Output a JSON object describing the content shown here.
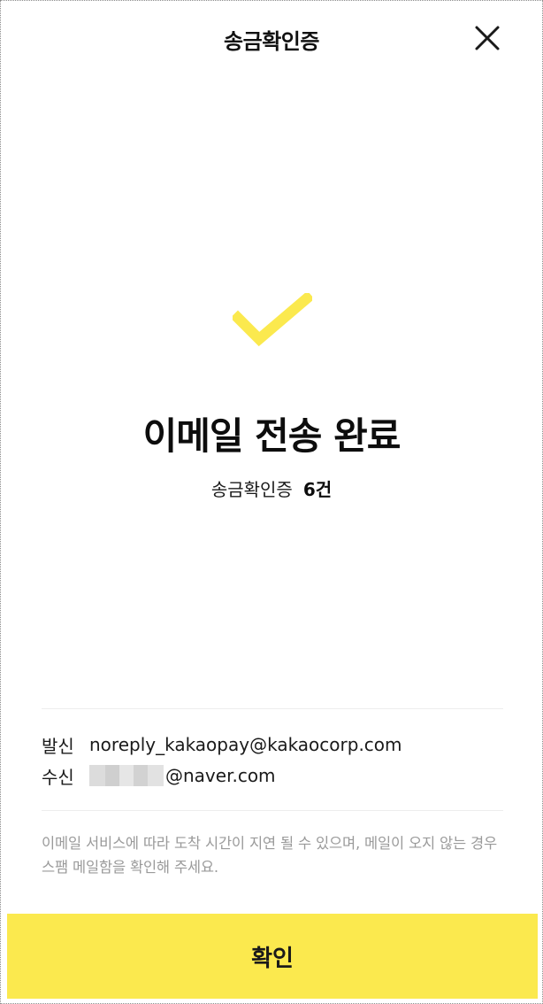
{
  "header": {
    "title": "송금확인증",
    "close_icon": "close-icon"
  },
  "result": {
    "icon": "checkmark-icon",
    "icon_color": "#fbe94e",
    "title": "이메일 전송 완료",
    "summary_label": "송금확인증",
    "summary_count": "6건"
  },
  "email": {
    "sender_label": "발신",
    "sender_value": "noreply_kakaopay@kakaocorp.com",
    "receiver_label": "수신",
    "receiver_domain": "@naver.com"
  },
  "notice": "이메일 서비스에 따라 도착 시간이 지연 될 수 있으며, 메일이 오지 않는 경우 스팸 메일함을 확인해 주세요.",
  "footer": {
    "confirm_label": "확인",
    "confirm_color": "#fbe94e"
  }
}
